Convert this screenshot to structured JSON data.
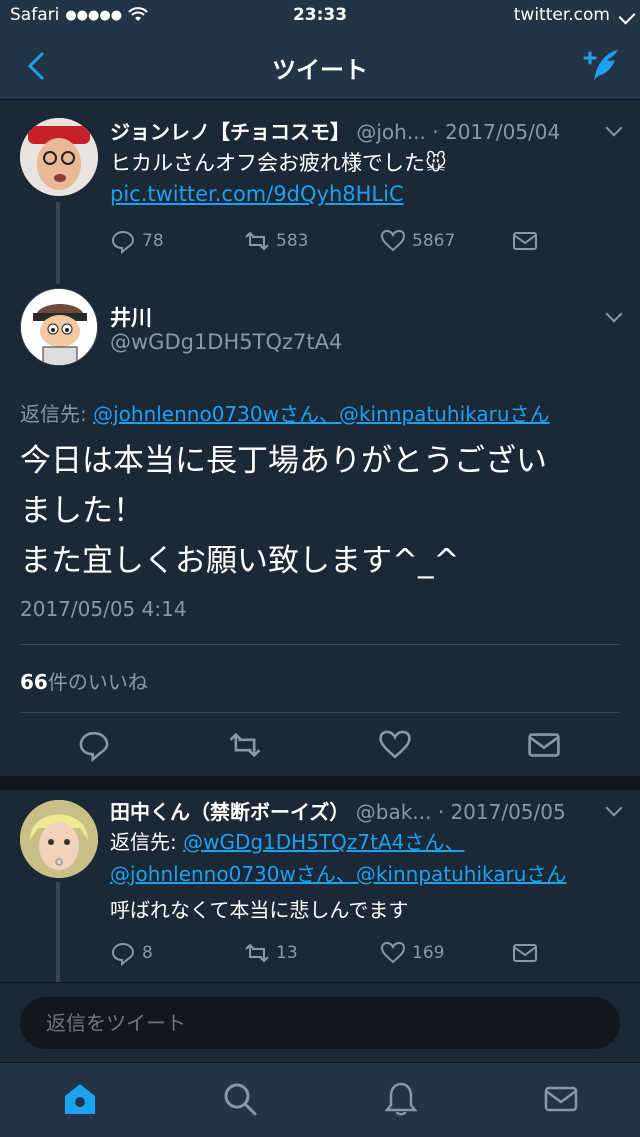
{
  "status_bar": {
    "carrier": "Safari",
    "signal": "●●●●●",
    "time": "23:33",
    "domain": "twitter.com"
  },
  "nav": {
    "title": "ツイート",
    "back_icon": "chevron-left-icon",
    "compose_icon": "compose-tweet-icon"
  },
  "colors": {
    "background": "#1b2836",
    "header": "#243447",
    "accent": "#1da1f2",
    "muted": "#8899a6"
  },
  "tweet1": {
    "name": "ジョンレノ【チョコスモ】",
    "handle": "@joh...",
    "date": "· 2017/05/04",
    "text": "ヒカルさんオフ会お疲れ様でした🐭",
    "link": "pic.twitter.com/9dQyh8HLiC",
    "replies": "78",
    "retweets": "583",
    "likes": "5867"
  },
  "main_tweet": {
    "name": "井川",
    "handle": "@wGDg1DH5TQz7tA4",
    "reply_to_label": "返信先: ",
    "reply_to_users": "@johnlenno0730wさん、@kinnpatuhikaruさん",
    "text_line1": "今日は本当に長丁場ありがとうござい",
    "text_line2": "ました！",
    "text_line3": "また宜しくお願い致します^_^",
    "timestamp": "2017/05/05 4:14",
    "likes_count": "66",
    "likes_label": "件のいいね"
  },
  "tweet3": {
    "name": "田中くん（禁断ボーイズ）",
    "handle": "@bak...",
    "date": "· 2017/05/05",
    "reply_to_label": "返信先: ",
    "reply_to_users_1": "@wGDg1DH5TQz7tA4さん、",
    "reply_to_users_2": "@johnlenno0730wさん、@kinnpatuhikaruさん",
    "text": "呼ばれなくて本当に悲しんでます",
    "replies": "8",
    "retweets": "13",
    "likes": "169"
  },
  "reply_bar": {
    "placeholder": "返信をツイート"
  },
  "tab_bar": {
    "items": [
      "home-icon",
      "search-icon",
      "notifications-icon",
      "messages-icon"
    ],
    "active": "home-icon"
  }
}
